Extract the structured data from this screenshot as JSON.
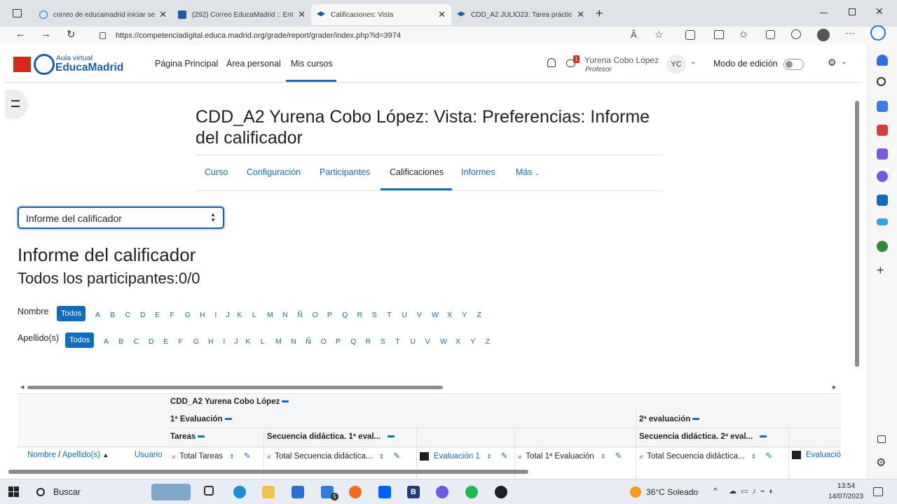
{
  "browser": {
    "tabs": [
      {
        "label": "correo de educamadrid iniciar se"
      },
      {
        "label": "(292) Correo EducaMadrid :: Entr"
      },
      {
        "label": "Calificaciones: Vista"
      },
      {
        "label": "CDD_A2 JULIO23: Tarea práctica"
      }
    ],
    "url": "https://competenciadigital.educa.madrid.org/grade/report/grader/index.php?id=3974"
  },
  "site": {
    "logo_line1": "Aula virtual",
    "logo_line2": "EducaMadrid",
    "nav": [
      "Página Principal",
      "Área personal",
      "Mis cursos"
    ],
    "notification_count": "1",
    "user_name": "Yurena Cobo López",
    "user_role": "Profesor",
    "user_initials": "YC",
    "edit_mode_label": "Modo de edición"
  },
  "page": {
    "title": "CDD_A2 Yurena Cobo López: Vista: Preferencias: Informe del calificador",
    "secondary_nav": [
      "Curso",
      "Configuración",
      "Participantes",
      "Calificaciones",
      "Informes",
      "Más"
    ],
    "report_select": "Informe del calificador",
    "heading": "Informe del calificador",
    "subheading": "Todos los participantes:0/0",
    "filter_first_label": "Nombre",
    "filter_last_label": "Apellido(s)",
    "todos_label": "Todos",
    "letters": [
      "A",
      "B",
      "C",
      "D",
      "E",
      "F",
      "G",
      "H",
      "I",
      "J",
      "K",
      "L",
      "M",
      "N",
      "Ñ",
      "O",
      "P",
      "Q",
      "R",
      "S",
      "T",
      "U",
      "V",
      "W",
      "X",
      "Y",
      "Z"
    ]
  },
  "grader": {
    "course": "CDD_A2 Yurena Cobo López",
    "cat1": "1ª Evaluación",
    "cat2": "2ª evaluación",
    "sub_tareas": "Tareas",
    "sub_seq1": "Secuencia didáctica. 1ª eval...",
    "sub_seq2": "Secuencia didáctica. 2ª eval...",
    "col_name": "Nombre",
    "col_sep": "/",
    "col_last": "Apellido(s)",
    "col_user": "Usuario",
    "items": [
      "Total Tareas",
      "Total Secuencia didáctica...",
      "Evaluación 1",
      "Total 1ª Evaluación",
      "Total Secuencia didáctica...",
      "Evaluació"
    ]
  },
  "taskbar": {
    "search_label": "Buscar",
    "mail_badge": "5",
    "weather": "36°C Soleado",
    "time": "13:54",
    "date": "14/07/2023"
  },
  "colors": {
    "accent": "#0f6cbf",
    "brand_red": "#d42a1c",
    "brand_blue": "#1b5da6"
  }
}
